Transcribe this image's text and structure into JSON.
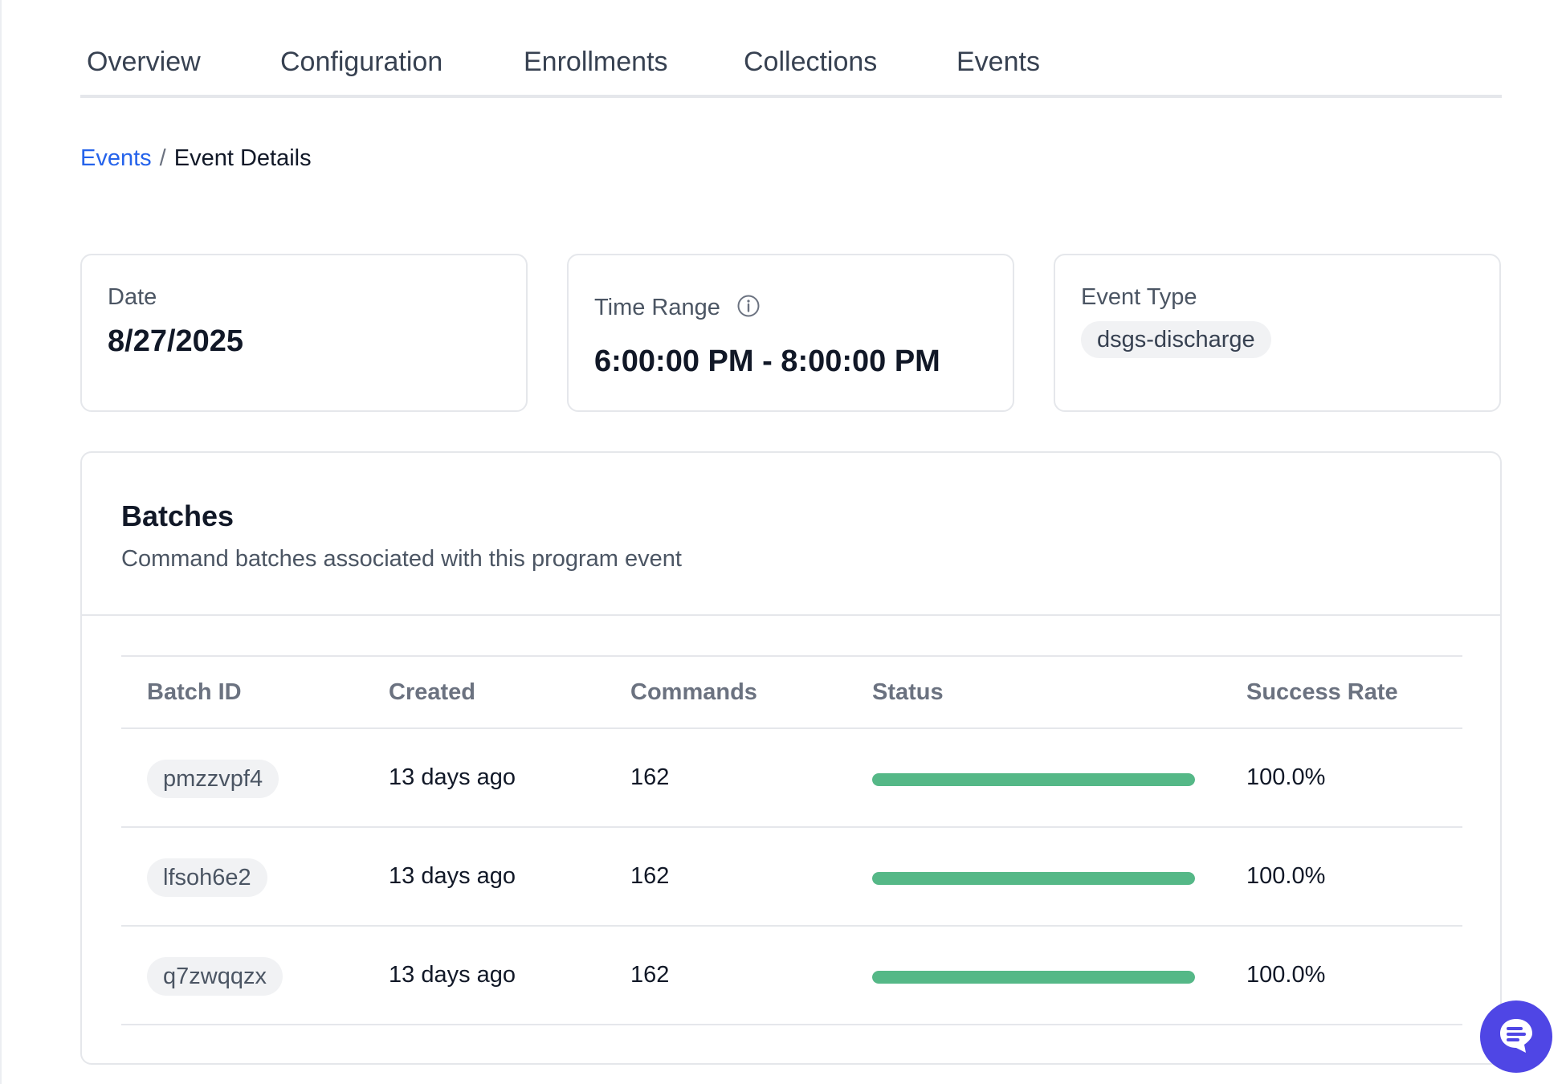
{
  "tabs": [
    {
      "label": "Overview"
    },
    {
      "label": "Configuration"
    },
    {
      "label": "Enrollments"
    },
    {
      "label": "Collections"
    },
    {
      "label": "Events"
    }
  ],
  "breadcrumb": {
    "parent": "Events",
    "separator": "/",
    "current": "Event Details"
  },
  "summary": {
    "date": {
      "label": "Date",
      "value": "8/27/2025"
    },
    "time_range": {
      "label": "Time Range",
      "value": "6:00:00 PM - 8:00:00 PM",
      "icon": "info-icon"
    },
    "event_type": {
      "label": "Event Type",
      "value": "dsgs-discharge"
    }
  },
  "batches": {
    "title": "Batches",
    "subtitle": "Command batches associated with this program event",
    "columns": [
      "Batch ID",
      "Created",
      "Commands",
      "Status",
      "Success Rate"
    ],
    "rows": [
      {
        "id": "pmzzvpf4",
        "created": "13 days ago",
        "commands": "162",
        "status_progress": 1.0,
        "success_rate": "100.0%"
      },
      {
        "id": "lfsoh6e2",
        "created": "13 days ago",
        "commands": "162",
        "status_progress": 1.0,
        "success_rate": "100.0%"
      },
      {
        "id": "q7zwqqzx",
        "created": "13 days ago",
        "commands": "162",
        "status_progress": 1.0,
        "success_rate": "100.0%"
      }
    ]
  },
  "colors": {
    "accent_link": "#2563eb",
    "success": "#55b887",
    "chat_button": "#4f46e5"
  },
  "chat": {
    "icon": "chat-icon"
  }
}
